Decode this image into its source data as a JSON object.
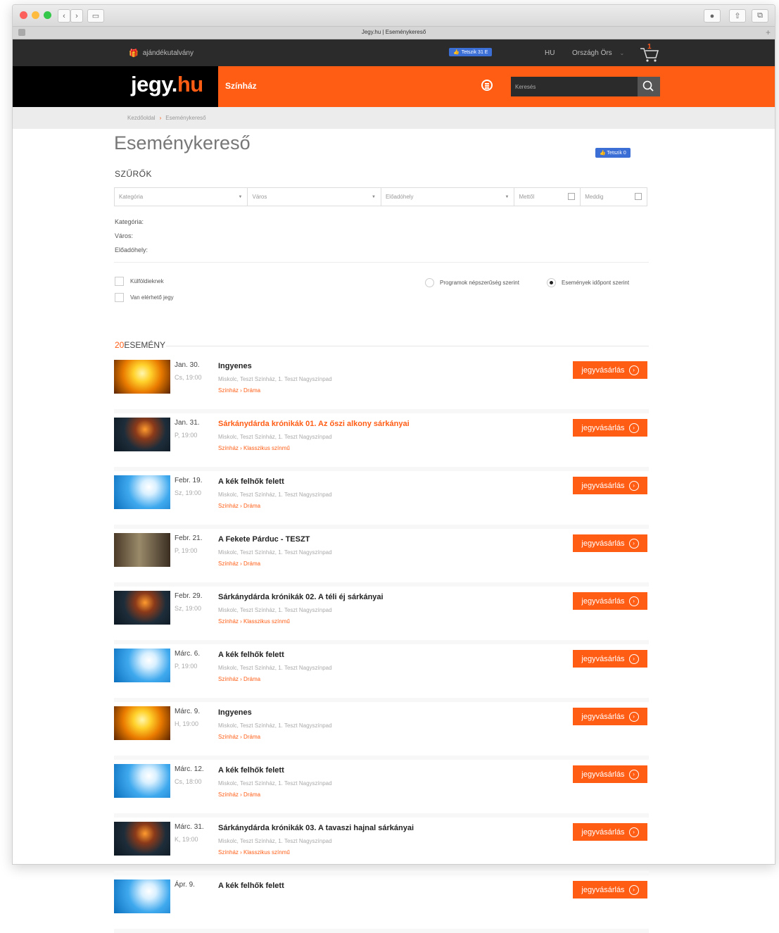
{
  "window": {
    "tab_title": "Jegy.hu | Eseménykereső"
  },
  "topbar": {
    "gift_label": "ajándékutalvány",
    "fb_like": "Tetszik 31 E",
    "lang": "HU",
    "user": "Országh Örs",
    "cart_count": "1"
  },
  "header": {
    "logo_main": "jegy",
    "logo_dot": ".",
    "logo_tld": "hu",
    "section": "Színház",
    "search_placeholder": "Keresés"
  },
  "breadcrumb": [
    "Kezdőoldal",
    "Eseménykereső"
  ],
  "page": {
    "title": "Eseménykereső",
    "fb_like": "Tetszik 0"
  },
  "filters": {
    "heading": "SZŰRŐK",
    "kategoria": "Kategória",
    "varos": "Város",
    "eloadohely": "Előadóhely",
    "metol": "Mettől",
    "meddig": "Meddig",
    "labels": [
      "Kategória:",
      "Város:",
      "Előadóhely:"
    ],
    "checkbox_foreign": "Külföldieknek",
    "checkbox_available": "Van elérhető jegy",
    "sort_popularity": "Programok népszerűség szerint",
    "sort_date": "Események időpont szerint"
  },
  "results": {
    "count": "20",
    "label": "ESEMÉNY"
  },
  "buy_label": "jegyvásárlás",
  "events": [
    {
      "date": "Jan. 30.",
      "time": "Cs, 19:00",
      "title": "Ingyenes",
      "venue": "Miskolc, Teszt Színház, 1. Teszt Nagyszínpad",
      "category": "Színház",
      "sub": "Dráma",
      "thumb": "sun"
    },
    {
      "date": "Jan. 31.",
      "time": "P, 19:00",
      "title": "Sárkánydárda krónikák 01. Az őszi alkony sárkányai",
      "venue": "Miskolc, Teszt Színház, 1. Teszt Nagyszínpad",
      "category": "Színház",
      "sub": "Klasszikus színmű",
      "thumb": "dragon"
    },
    {
      "date": "Febr. 19.",
      "time": "Sz, 19:00",
      "title": "A kék felhők felett",
      "venue": "Miskolc, Teszt Színház, 1. Teszt Nagyszínpad",
      "category": "Színház",
      "sub": "Dráma",
      "thumb": "sky"
    },
    {
      "date": "Febr. 21.",
      "time": "P, 19:00",
      "title": "A Fekete Párduc - TESZT",
      "venue": "Miskolc, Teszt Színház, 1. Teszt Nagyszínpad",
      "category": "Színház",
      "sub": "Dráma",
      "thumb": "panther"
    },
    {
      "date": "Febr. 29.",
      "time": "Sz, 19:00",
      "title": "Sárkánydárda krónikák 02. A téli éj sárkányai",
      "venue": "Miskolc, Teszt Színház, 1. Teszt Nagyszínpad",
      "category": "Színház",
      "sub": "Klasszikus színmű",
      "thumb": "dragon"
    },
    {
      "date": "Márc. 6.",
      "time": "P, 19:00",
      "title": "A kék felhők felett",
      "venue": "Miskolc, Teszt Színház, 1. Teszt Nagyszínpad",
      "category": "Színház",
      "sub": "Dráma",
      "thumb": "sky"
    },
    {
      "date": "Márc. 9.",
      "time": "H, 19:00",
      "title": "Ingyenes",
      "venue": "Miskolc, Teszt Színház, 1. Teszt Nagyszínpad",
      "category": "Színház",
      "sub": "Dráma",
      "thumb": "sun"
    },
    {
      "date": "Márc. 12.",
      "time": "Cs, 18:00",
      "title": "A kék felhők felett",
      "venue": "Miskolc, Teszt Színház, 1. Teszt Nagyszínpad",
      "category": "Színház",
      "sub": "Dráma",
      "thumb": "sky"
    },
    {
      "date": "Márc. 31.",
      "time": "K, 19:00",
      "title": "Sárkánydárda krónikák 03. A tavaszi hajnal sárkányai",
      "venue": "Miskolc, Teszt Színház, 1. Teszt Nagyszínpad",
      "category": "Színház",
      "sub": "Klasszikus színmű",
      "thumb": "dragon"
    },
    {
      "date": "Ápr. 9.",
      "time": "",
      "title": "A kék felhők felett",
      "venue": "",
      "category": "",
      "sub": "",
      "thumb": "sky"
    }
  ],
  "colors": {
    "brand": "#ff5c14",
    "dark": "#2b2b2b"
  }
}
